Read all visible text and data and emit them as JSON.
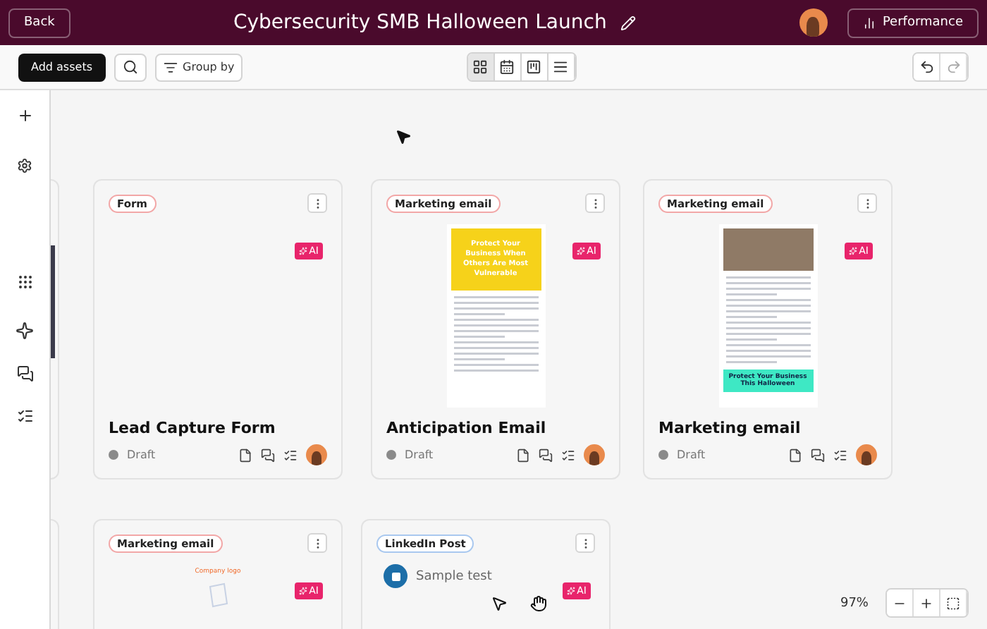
{
  "header": {
    "back": "Back",
    "title": "Cybersecurity SMB Halloween Launch",
    "performance": "Performance"
  },
  "toolbar": {
    "add_assets": "Add assets",
    "group_by": "Group by",
    "views": [
      {
        "kind": "grid",
        "selected": true
      },
      {
        "kind": "calendar",
        "selected": false
      },
      {
        "kind": "board",
        "selected": false
      },
      {
        "kind": "list",
        "selected": false
      }
    ]
  },
  "cards": [
    {
      "tag": "Form",
      "color": "#f2a7a7",
      "ai_badge": "AI",
      "kind": "blank",
      "title": "Lead Capture Form",
      "status": "Draft"
    },
    {
      "tag": "Marketing email",
      "color": "#f2a7a7",
      "ai_badge": "AI",
      "kind": "yellow",
      "headline": "Protect Your Business When Others Are Most Vulnerable",
      "title": "Anticipation Email",
      "status": "Draft"
    },
    {
      "tag": "Marketing email",
      "color": "#f2a7a7",
      "ai_badge": "AI",
      "kind": "photo",
      "headline": "Protect Your Business This Halloween",
      "title": "Marketing email",
      "status": "Draft"
    },
    {
      "tag": "Marketing email",
      "color": "#f2a7a7",
      "ai_badge": "AI",
      "kind": "logo",
      "headline": "Company logo"
    },
    {
      "tag": "LinkedIn Post",
      "color": "#a9c8ef",
      "ai_badge": "AI",
      "kind": "linkedin",
      "headline": "Sample test"
    }
  ],
  "zoom": {
    "value": "97%"
  }
}
